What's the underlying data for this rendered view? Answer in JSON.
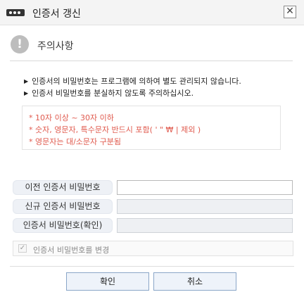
{
  "window": {
    "title": "인증서 갱신",
    "close_symbol": "✕",
    "app_icon": "certificate-card-icon"
  },
  "notice": {
    "icon_symbol": "!",
    "icon_name": "exclamation-icon",
    "title": "주의사항",
    "lines": [
      "인증서의 비밀번호는 프로그램에 의하여 별도 관리되지 않습니다.",
      "인증서 비밀번호를 분실하지 않도록 주의하십시오."
    ],
    "bullet_symbol": "▶"
  },
  "rules": [
    "* 10자 이상 ~ 30자 이하",
    "* 숫자, 영문자, 특수문자 반드시 포함( ' \" ₩ | 제외 )",
    "* 영문자는 대/소문자 구분됨"
  ],
  "form": {
    "fields": [
      {
        "label": "이전 인증서 비밀번호",
        "value": "",
        "enabled": true
      },
      {
        "label": "신규 인증서 비밀번호",
        "value": "",
        "enabled": false
      },
      {
        "label": "인증서 비밀번호(확인)",
        "value": "",
        "enabled": false
      }
    ],
    "change_password_checkbox": {
      "label": "인증서 비밀번호를 변경",
      "checked": true,
      "check_symbol": "✓"
    }
  },
  "buttons": {
    "ok": "확인",
    "cancel": "취소"
  },
  "colors": {
    "rule_text": "#e05a4e",
    "button_border": "#8aa6c8",
    "label_bg": "#eef1f6"
  }
}
